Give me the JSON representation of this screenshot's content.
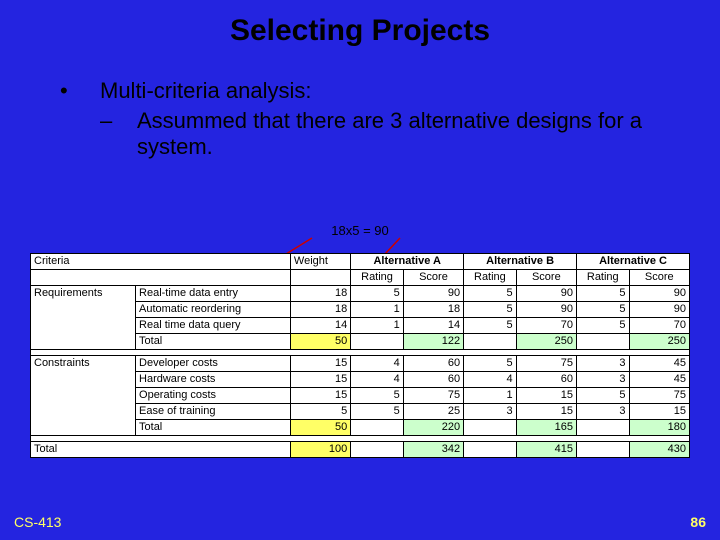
{
  "title": "Selecting Projects",
  "bullet": "Multi-criteria analysis:",
  "sub": "Assummed that there are 3 alternative designs for a system.",
  "annotation": "18x5 = 90",
  "footer_left": "CS-413",
  "footer_right": "86",
  "headers": {
    "criteria": "Criteria",
    "weight": "Weight",
    "altA": "Alternative A",
    "altB": "Alternative B",
    "altC": "Alternative C",
    "rating": "Rating",
    "score": "Score"
  },
  "groups": [
    {
      "label": "Requirements",
      "rows": [
        {
          "name": "Real-time data entry",
          "weight": 18,
          "A": {
            "r": 5,
            "s": 90
          },
          "B": {
            "r": 5,
            "s": 90
          },
          "C": {
            "r": 5,
            "s": 90
          }
        },
        {
          "name": "Automatic reordering",
          "weight": 18,
          "A": {
            "r": 1,
            "s": 18
          },
          "B": {
            "r": 5,
            "s": 90
          },
          "C": {
            "r": 5,
            "s": 90
          }
        },
        {
          "name": "Real time data query",
          "weight": 14,
          "A": {
            "r": 1,
            "s": 14
          },
          "B": {
            "r": 5,
            "s": 70
          },
          "C": {
            "r": 5,
            "s": 70
          }
        }
      ],
      "total": {
        "label": "Total",
        "weight": 50,
        "A": 122,
        "B": 250,
        "C": 250
      }
    },
    {
      "label": "Constraints",
      "rows": [
        {
          "name": "Developer costs",
          "weight": 15,
          "A": {
            "r": 4,
            "s": 60
          },
          "B": {
            "r": 5,
            "s": 75
          },
          "C": {
            "r": 3,
            "s": 45
          }
        },
        {
          "name": "Hardware costs",
          "weight": 15,
          "A": {
            "r": 4,
            "s": 60
          },
          "B": {
            "r": 4,
            "s": 60
          },
          "C": {
            "r": 3,
            "s": 45
          }
        },
        {
          "name": "Operating costs",
          "weight": 15,
          "A": {
            "r": 5,
            "s": 75
          },
          "B": {
            "r": 1,
            "s": 15
          },
          "C": {
            "r": 5,
            "s": 75
          }
        },
        {
          "name": "Ease of training",
          "weight": 5,
          "A": {
            "r": 5,
            "s": 25
          },
          "B": {
            "r": 3,
            "s": 15
          },
          "C": {
            "r": 3,
            "s": 15
          }
        }
      ],
      "total": {
        "label": "Total",
        "weight": 50,
        "A": 220,
        "B": 165,
        "C": 180
      }
    }
  ],
  "grand": {
    "label": "Total",
    "weight": 100,
    "A": 342,
    "B": 415,
    "C": 430
  }
}
